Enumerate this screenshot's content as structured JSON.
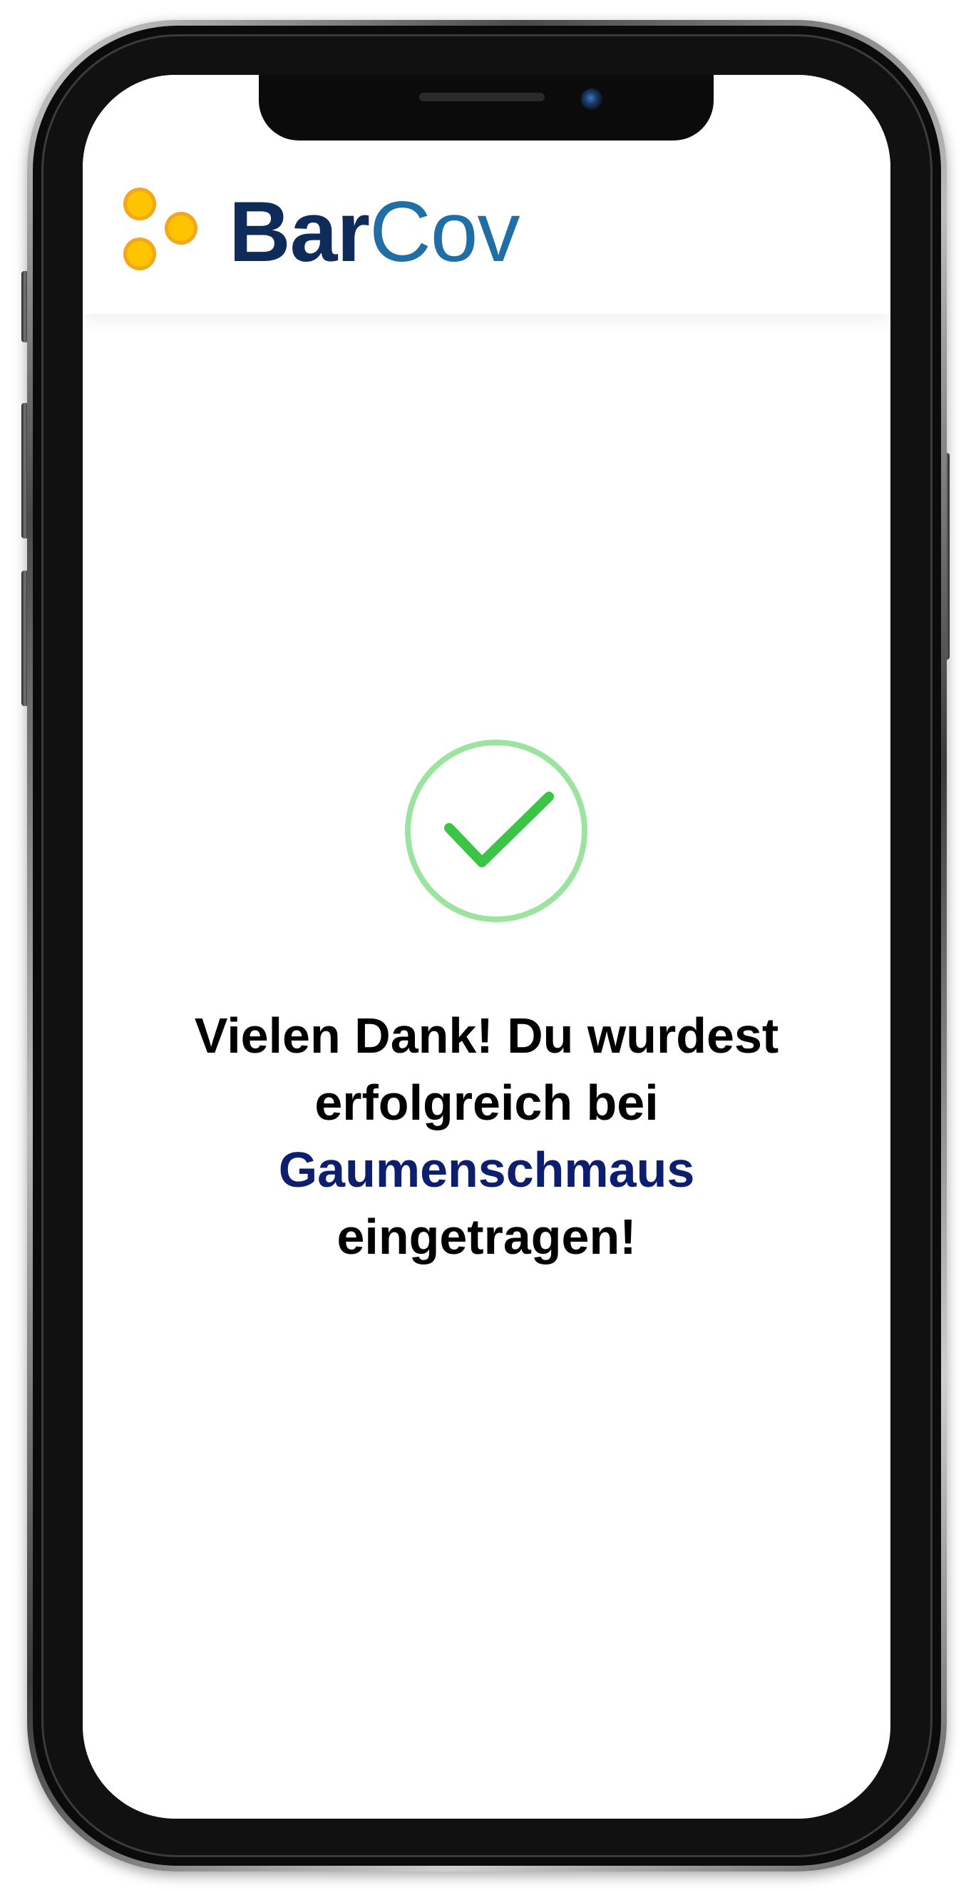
{
  "app": {
    "brand_primary": "Bar",
    "brand_secondary": "Cov",
    "logo_icon": "three-dots-icon",
    "brand_colors": {
      "bar": "#0f2b5a",
      "cov": "#1f6ea6",
      "dots": "#ffc400"
    }
  },
  "confirmation": {
    "icon": "checkmark-circle-icon",
    "icon_color": "#3cc447",
    "ring_color": "#9be39f",
    "message_before": "Vielen Dank! Du wurdest erfolgreich bei",
    "venue": "Gaumenschmaus",
    "message_after": "eingetragen!",
    "venue_color": "#0d1e6e"
  }
}
